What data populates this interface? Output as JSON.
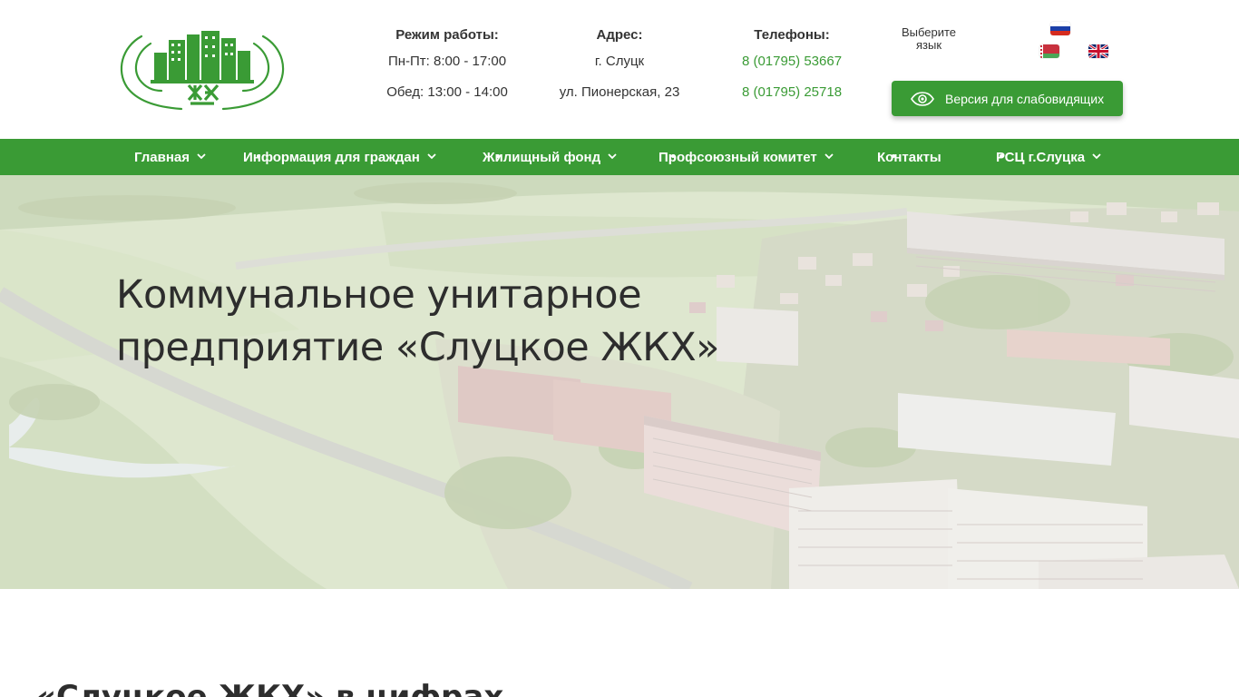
{
  "header": {
    "hours": {
      "title": "Режим работы:",
      "line1": "Пн-Пт: 8:00 - 17:00",
      "line2": "Обед: 13:00 - 14:00"
    },
    "address": {
      "title": "Адрес:",
      "line1": "г. Слуцк",
      "line2": "ул. Пионерская, 23"
    },
    "phones": {
      "title": "Телефоны:",
      "phone1": "8 (01795) 53667",
      "phone2": "8 (01795) 25718"
    },
    "language": {
      "label": "Выберите язык",
      "flags": [
        "ru-flag-icon",
        "by-flag-icon",
        "en-flag-icon"
      ]
    },
    "vision_button": {
      "label": "Версия для слабовидящих",
      "icon": "eye-icon"
    }
  },
  "nav": {
    "items": [
      {
        "label": "Главная"
      },
      {
        "label": "Информация для граждан"
      },
      {
        "label": "Жилищный фонд"
      },
      {
        "label": "Профсоюзный комитет"
      },
      {
        "label": "Контакты"
      },
      {
        "label": "РСЦ г.Слуцка"
      }
    ]
  },
  "hero": {
    "title_line1": "Коммунальное унитарное",
    "title_line2": "предприятие «Слуцкое ЖКХ»"
  },
  "stats": {
    "title": "«Слуцкое ЖКХ» в цифрах"
  },
  "colors": {
    "brand_green": "#3a9b35",
    "text_dark": "#2d2d2d"
  }
}
